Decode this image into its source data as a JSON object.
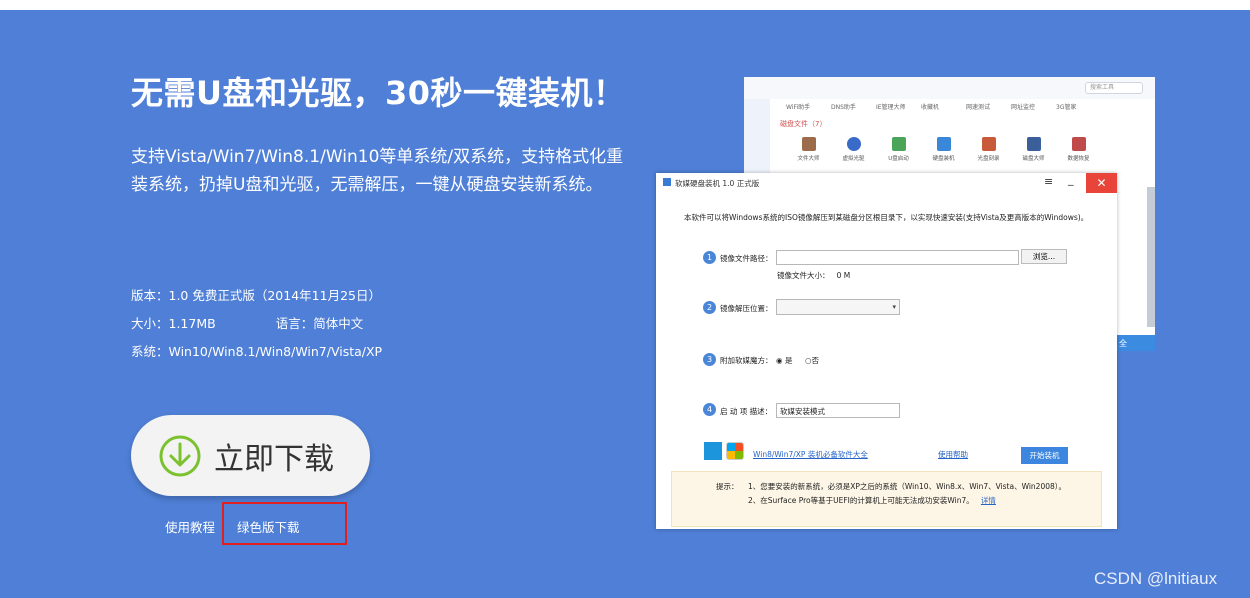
{
  "hero": {
    "headline": "无需U盘和光驱，30秒一键装机！",
    "description": "支持Vista/Win7/Win8.1/Win10等单系统/双系统，支持格式化重装系统，扔掉U盘和光驱，无需解压，一键从硬盘安装新系统。",
    "version": "版本：1.0 免费正式版（2014年11月25日）",
    "size": "大小：1.17MB",
    "language": "语言：简体中文",
    "systems": "系统：Win10/Win8.1/Win8/Win7/Vista/XP",
    "download_label": "立即下载",
    "tutorial_link": "使用教程",
    "green_download_link": "绿色版下载",
    "highlight_color": "#e0201f"
  },
  "bg_app": {
    "search_placeholder": "搜索工具",
    "tabs": [
      "WiFi助手",
      "DNS助手",
      "IE管理大师",
      "收藏机",
      "网速测试",
      "网址监控",
      "3G管家"
    ],
    "category": "磁盘文件（7）",
    "items": [
      "文件大师",
      "虚拟光驱",
      "U盘启动",
      "硬盘装机",
      "光盘刻录",
      "磁盘大师",
      "数据恢复"
    ],
    "partial_label": "全"
  },
  "dialog": {
    "title": "软媒硬盘装机 1.0 正式版",
    "menu_icon": "≡",
    "minimize_icon": "_",
    "close_icon": "✕",
    "intro": "本软件可以将Windows系统的ISO镜像解压到某磁盘分区根目录下，以实现快速安装(支持Vista及更高版本的Windows)。",
    "step1": {
      "num": "1",
      "label": "镜像文件路径：",
      "value": "",
      "browse": "浏览...",
      "size_label": "镜像文件大小：",
      "size_value": "0 M"
    },
    "step2": {
      "num": "2",
      "label": "镜像解压位置：",
      "value": ""
    },
    "step3": {
      "num": "3",
      "label": "附加软媒魔方：",
      "yes": "是",
      "no": "否"
    },
    "step4": {
      "num": "4",
      "label": "启 动 项 描述：",
      "value": "软媒安装模式"
    },
    "essentials_link": "Win8/Win7/XP 装机必备软件大全",
    "help_link": "使用帮助",
    "start_button": "开始装机",
    "tips_key": "提示：",
    "tip1": "1、您要安装的新系统，必须是XP之后的系统（Win10、Win8.x、Win7、Vista、Win2008）。",
    "tip2": "2、在Surface Pro等基于UEFI的计算机上可能无法成功安装Win7。",
    "tip2_link": "详情"
  },
  "watermark": "CSDN @lnitiaux"
}
